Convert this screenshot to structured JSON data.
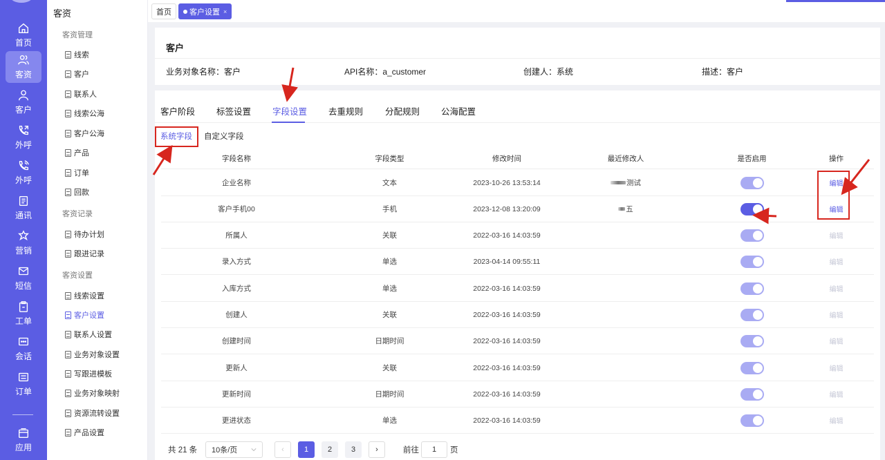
{
  "rail": {
    "items": [
      {
        "label": "首页",
        "icon": "home-icon"
      },
      {
        "label": "客资",
        "icon": "users-icon"
      },
      {
        "label": "客户",
        "icon": "user-icon"
      },
      {
        "label": "外呼",
        "icon": "phone-out-icon"
      },
      {
        "label": "外呼",
        "icon": "phone-call-icon"
      },
      {
        "label": "通讯",
        "icon": "contacts-icon"
      },
      {
        "label": "营销",
        "icon": "marketing-icon"
      },
      {
        "label": "短信",
        "icon": "sms-icon"
      },
      {
        "label": "工单",
        "icon": "clipboard-icon"
      },
      {
        "label": "会话",
        "icon": "chat-icon"
      },
      {
        "label": "订单",
        "icon": "order-icon"
      },
      {
        "label": "应用",
        "icon": "app-icon"
      }
    ]
  },
  "subnav": {
    "title": "客资",
    "groups": [
      {
        "label": "客资管理",
        "items": [
          "线索",
          "客户",
          "联系人",
          "线索公海",
          "客户公海",
          "产品",
          "订单",
          "回款"
        ]
      },
      {
        "label": "客资记录",
        "items": [
          "待办计划",
          "跟进记录"
        ]
      },
      {
        "label": "客资设置",
        "items": [
          "线索设置",
          "客户设置",
          "联系人设置",
          "业务对象设置",
          "写跟进模板",
          "业务对象映射",
          "资源流转设置",
          "产品设置"
        ]
      }
    ]
  },
  "pagetabs": [
    {
      "label": "首页"
    },
    {
      "label": "客户设置",
      "close": "×"
    }
  ],
  "object": {
    "title": "客户",
    "name_label": "业务对象名称：客户",
    "api_label": "API名称：a_customer",
    "creator_label": "创建人：系统",
    "desc_label": "描述：客户"
  },
  "tabs": [
    "客户阶段",
    "标签设置",
    "字段设置",
    "去重规则",
    "分配规则",
    "公海配置"
  ],
  "subtabs": [
    "系统字段",
    "自定义字段"
  ],
  "table": {
    "headers": [
      "字段名称",
      "字段类型",
      "修改时间",
      "最近修改人",
      "是否启用",
      "操作"
    ],
    "edit_label": "编辑",
    "rows": [
      {
        "name": "企业名称",
        "type": "文本",
        "time": "2023-10-26 13:53:14",
        "modifier": "测试",
        "enabled": 0.5,
        "editable": true
      },
      {
        "name": "客户手机00",
        "type": "手机",
        "time": "2023-12-08 13:20:09",
        "modifier": "五",
        "enabled": 1,
        "editable": true
      },
      {
        "name": "所属人",
        "type": "关联",
        "time": "2022-03-16 14:03:59",
        "modifier": "",
        "enabled": 0.5,
        "editable": false
      },
      {
        "name": "录入方式",
        "type": "单选",
        "time": "2023-04-14 09:55:11",
        "modifier": "",
        "enabled": 0.5,
        "editable": false
      },
      {
        "name": "入库方式",
        "type": "单选",
        "time": "2022-03-16 14:03:59",
        "modifier": "",
        "enabled": 0.5,
        "editable": false
      },
      {
        "name": "创建人",
        "type": "关联",
        "time": "2022-03-16 14:03:59",
        "modifier": "",
        "enabled": 0.5,
        "editable": false
      },
      {
        "name": "创建时间",
        "type": "日期时间",
        "time": "2022-03-16 14:03:59",
        "modifier": "",
        "enabled": 0.5,
        "editable": false
      },
      {
        "name": "更新人",
        "type": "关联",
        "time": "2022-03-16 14:03:59",
        "modifier": "",
        "enabled": 0.5,
        "editable": false
      },
      {
        "name": "更新时间",
        "type": "日期时间",
        "time": "2022-03-16 14:03:59",
        "modifier": "",
        "enabled": 0.5,
        "editable": false
      },
      {
        "name": "更进状态",
        "type": "单选",
        "time": "2022-03-16 14:03:59",
        "modifier": "",
        "enabled": 0.5,
        "editable": false
      }
    ]
  },
  "pagination": {
    "total": "共 21 条",
    "page_size": "10条/页",
    "pages": [
      "1",
      "2",
      "3"
    ],
    "current": "1",
    "goto_label": "前往",
    "goto_value": "1",
    "page_suffix": "页",
    "prev": "‹",
    "next": "›"
  },
  "colors": {
    "accent": "#5b5de3",
    "annotation": "#d7261e"
  }
}
